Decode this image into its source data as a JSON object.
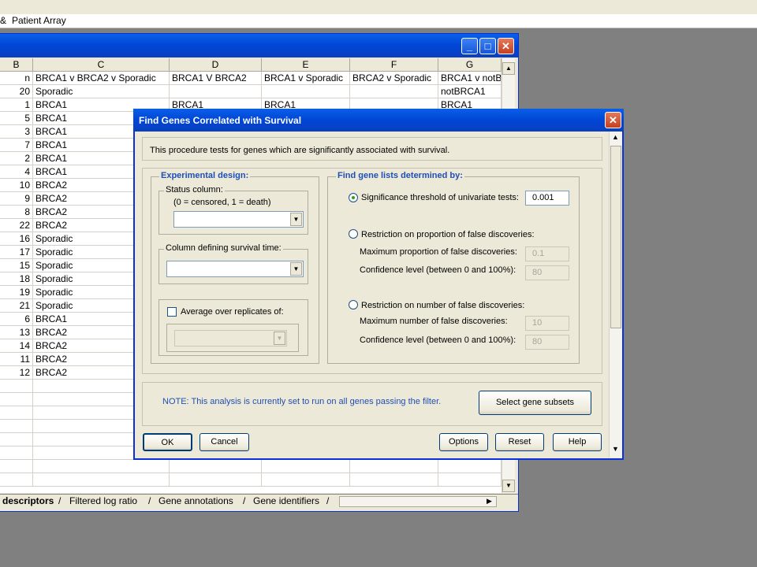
{
  "app": {
    "window_title": "Patient Array",
    "title_icon": "&"
  },
  "sheet": {
    "column_headers": [
      "B",
      "C",
      "D",
      "E",
      "F",
      "G"
    ],
    "rows": [
      [
        "n",
        "BRCA1 v BRCA2 v Sporadic",
        "BRCA1 V BRCA2",
        "BRCA1 v Sporadic",
        "BRCA2 v Sporadic",
        "BRCA1 v notB"
      ],
      [
        "20",
        "Sporadic",
        "",
        "",
        "",
        "notBRCA1"
      ],
      [
        "1",
        "BRCA1",
        "BRCA1",
        "BRCA1",
        "",
        "BRCA1"
      ],
      [
        "5",
        "BRCA1",
        "",
        "",
        "",
        ""
      ],
      [
        "3",
        "BRCA1",
        "",
        "",
        "",
        ""
      ],
      [
        "7",
        "BRCA1",
        "",
        "",
        "",
        ""
      ],
      [
        "2",
        "BRCA1",
        "",
        "",
        "",
        ""
      ],
      [
        "4",
        "BRCA1",
        "",
        "",
        "",
        ""
      ],
      [
        "10",
        "BRCA2",
        "",
        "",
        "",
        ""
      ],
      [
        "9",
        "BRCA2",
        "",
        "",
        "",
        ""
      ],
      [
        "8",
        "BRCA2",
        "",
        "",
        "",
        ""
      ],
      [
        "22",
        "BRCA2",
        "",
        "",
        "",
        ""
      ],
      [
        "16",
        "Sporadic",
        "",
        "",
        "",
        ""
      ],
      [
        "17",
        "Sporadic",
        "",
        "",
        "",
        ""
      ],
      [
        "15",
        "Sporadic",
        "",
        "",
        "",
        ""
      ],
      [
        "18",
        "Sporadic",
        "",
        "",
        "",
        ""
      ],
      [
        "19",
        "Sporadic",
        "",
        "",
        "",
        ""
      ],
      [
        "21",
        "Sporadic",
        "",
        "",
        "",
        ""
      ],
      [
        "6",
        "BRCA1",
        "",
        "",
        "",
        ""
      ],
      [
        "13",
        "BRCA2",
        "",
        "",
        "",
        ""
      ],
      [
        "14",
        "BRCA2",
        "",
        "",
        "",
        ""
      ],
      [
        "11",
        "BRCA2",
        "",
        "",
        "",
        ""
      ],
      [
        "12",
        "BRCA2",
        "",
        "",
        "",
        ""
      ]
    ],
    "tabs": [
      "descriptors",
      "Filtered log ratio",
      "Gene annotations",
      "Gene identifiers"
    ]
  },
  "dialog": {
    "title": "Find Genes Correlated with Survival",
    "description": "This procedure tests for genes which are significantly associated with survival.",
    "experimental_design": {
      "label": "Experimental design:",
      "status_column_label": "Status column:",
      "status_hint": "(0 = censored, 1 = death)",
      "status_value": "",
      "survival_time_label": "Column defining survival time:",
      "survival_time_value": "",
      "average_replicates_label": "Average over replicates of:",
      "average_replicates_checked": false
    },
    "gene_lists": {
      "label": "Find gene lists determined by:",
      "significance_label": "Significance threshold of univariate tests:",
      "significance_value": "0.001",
      "significance_selected": true,
      "proportion_label": "Restriction on proportion of false discoveries:",
      "max_proportion_label": "Maximum proportion of false discoveries:",
      "max_proportion_value": "0.1",
      "confidence_label_1": "Confidence level (between 0 and 100%):",
      "confidence_value_1": "80",
      "number_label": "Restriction on number of false discoveries:",
      "max_number_label": "Maximum number of false discoveries:",
      "max_number_value": "10",
      "confidence_label_2": "Confidence level (between 0 and 100%):",
      "confidence_value_2": "80"
    },
    "note": "NOTE:  This analysis is currently set to run on all genes passing the filter.",
    "buttons": {
      "select_subsets": "Select gene subsets",
      "ok": "OK",
      "cancel": "Cancel",
      "options": "Options",
      "reset": "Reset",
      "help": "Help"
    }
  },
  "colors": {
    "titlebar": "#0046d5",
    "dialog_bg": "#ece9d8",
    "label_blue": "#1f4fb5",
    "desktop": "#808080"
  }
}
